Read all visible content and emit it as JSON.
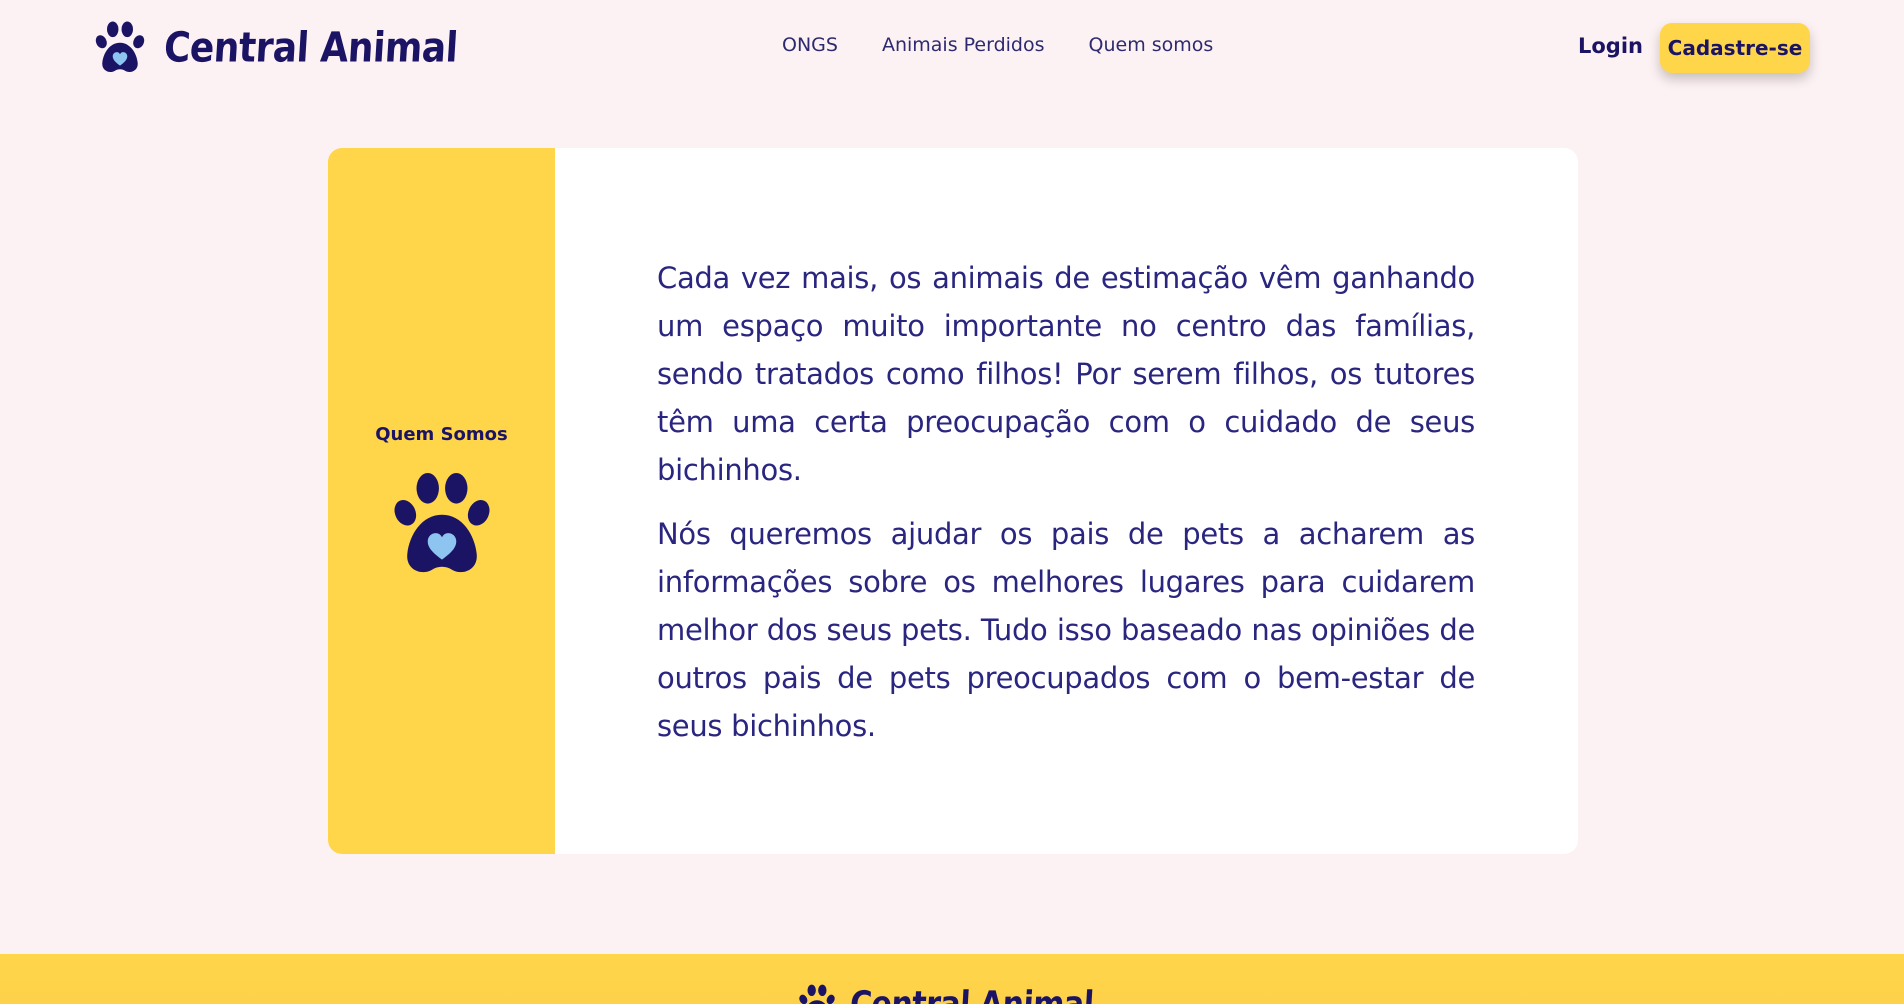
{
  "header": {
    "brand_name": "Central Animal",
    "brand_icon": "paw-heart-icon",
    "nav": [
      "ONGS",
      "Animais Perdidos",
      "Quem somos"
    ],
    "login_label": "Login",
    "signup_label": "Cadastre-se"
  },
  "about": {
    "side_title": "Quem Somos",
    "side_icon": "paw-heart-icon",
    "paragraphs": [
      "Cada vez mais, os animais de estimação vêm ganhando um espaço muito importante no centro das famílias, sendo tratados como filhos! Por serem filhos, os tutores têm uma certa preocupação com o cuidado de seus bichinhos.",
      "Nós queremos ajudar os pais de pets a acharem as informações sobre os melhores lugares para cuidarem melhor dos seus pets. Tudo isso baseado nas opiniões de outros pais de pets preocupados com o bem-estar de seus bichinhos."
    ]
  },
  "footer": {
    "brand_name": "Central Animal"
  },
  "colors": {
    "background": "#fdf2f3",
    "accent_yellow": "#ffd54a",
    "navy": "#1b1464",
    "heart_blue": "#8ec5f0"
  }
}
